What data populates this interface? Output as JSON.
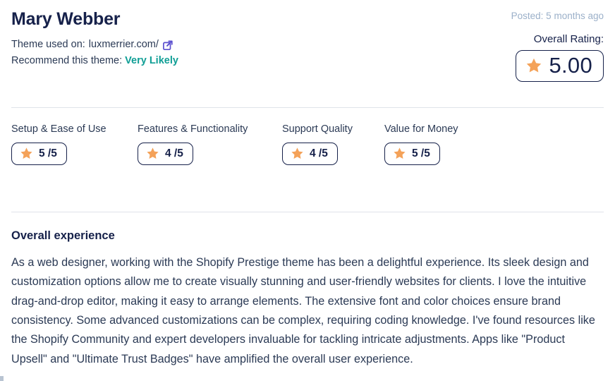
{
  "review": {
    "reviewer_name": "Mary Webber",
    "theme_used_label": "Theme used on:",
    "theme_url": "luxmerrier.com/",
    "external_link_icon": "external-link-icon",
    "recommend_label": "Recommend this theme:",
    "recommend_value": "Very Likely",
    "posted": "Posted: 5 months ago",
    "overall_rating_label": "Overall Rating:",
    "overall_rating_value": "5.00",
    "star_icon": "star-icon",
    "categories": [
      {
        "label": "Setup & Ease of Use",
        "score": "5 /5"
      },
      {
        "label": "Features & Functionality",
        "score": "4 /5"
      },
      {
        "label": "Support Quality",
        "score": "4 /5"
      },
      {
        "label": "Value for Money",
        "score": "5 /5"
      }
    ],
    "experience_heading": "Overall experience",
    "experience_body": "As a web designer, working with the Shopify Prestige theme has been a delightful experience. Its sleek design and customization options allow me to create visually stunning and user-friendly websites for clients. I love the intuitive drag-and-drop editor, making it easy to arrange elements. The extensive font and color choices ensure brand consistency. Some advanced customizations can be complex, requiring coding knowledge. I've found resources like the Shopify Community and expert developers invaluable for tackling intricate adjustments. Apps like \"Product Upsell\" and \"Ultimate Trust Badges\" have amplified the overall user experience."
  },
  "colors": {
    "star": "#F4A259",
    "text_dark": "#16214a",
    "text_body": "#2b3a55",
    "recommend": "#0f9e95",
    "posted": "#9bb0c9",
    "divider": "#dfe3e9",
    "link_icon": "#5b4fcf"
  }
}
